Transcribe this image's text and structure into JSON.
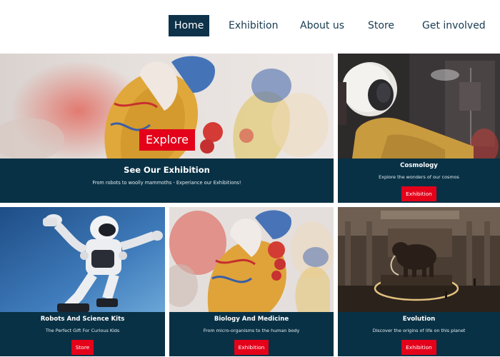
{
  "nav": {
    "home": "Home",
    "exhibition": "Exhibition",
    "about": "About us",
    "store": "Store",
    "involved": "Get involved"
  },
  "hero": {
    "button": "Explore",
    "title": "See Our Exhibition",
    "subtitle": "From robots to woolly mammoths - Experiance our Exhibitions!"
  },
  "cards": {
    "cosmology": {
      "title": "Cosmology",
      "subtitle": "Explore the wonders of our cosmos",
      "button": "Exhibition"
    },
    "robots": {
      "title": "Robots And Science Kits",
      "subtitle": "The Perfect Gift For Curious Kids",
      "button": "Store"
    },
    "biology": {
      "title": "Biology And Medicine",
      "subtitle": "From micro-organisms to the human body",
      "button": "Exhibition"
    },
    "evolution": {
      "title": "Evolution",
      "subtitle": "Discover the origins of life on this planet",
      "button": "Exhibition"
    }
  },
  "colors": {
    "nav_active": "#0d3249",
    "caption_bg": "#083145",
    "button_red": "#e3021a"
  }
}
